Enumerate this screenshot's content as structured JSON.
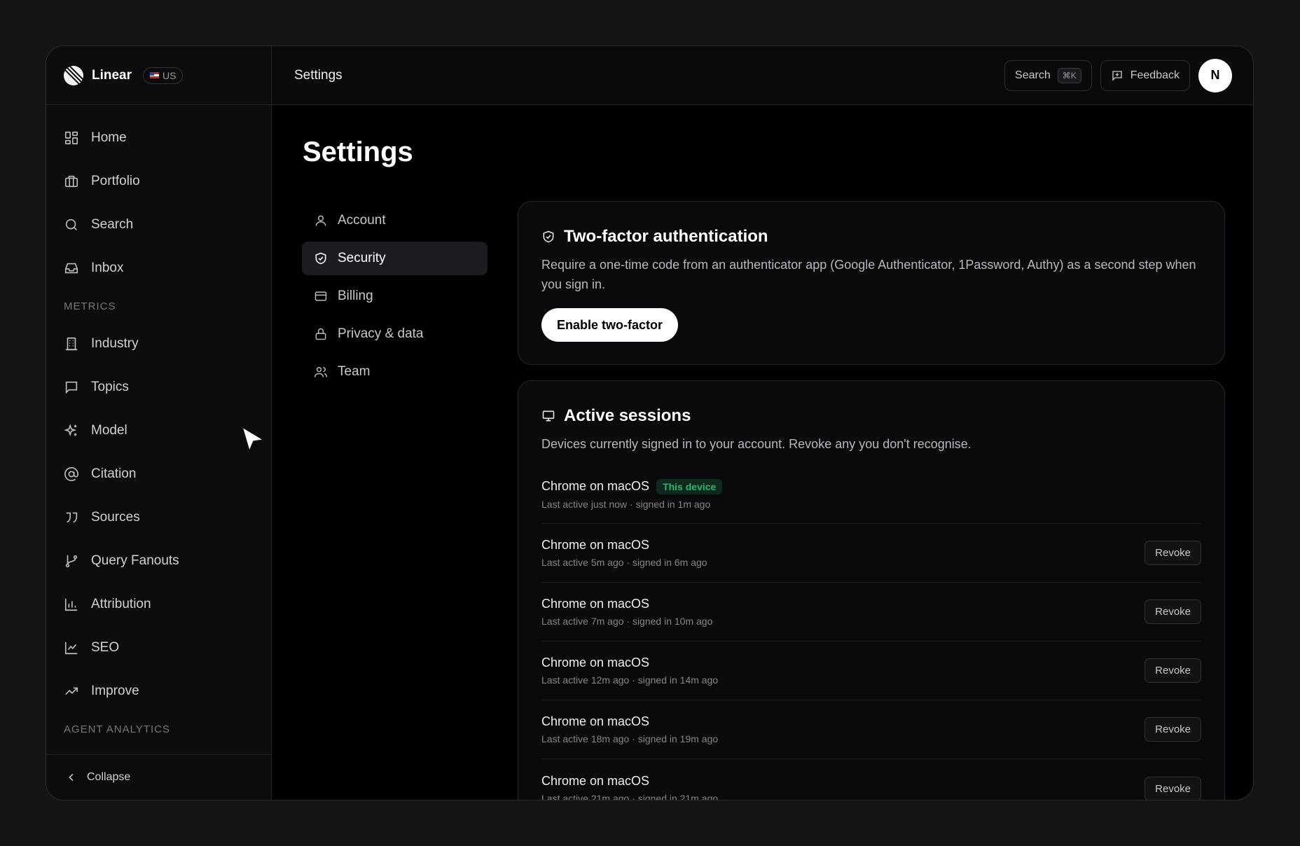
{
  "brand": {
    "name": "Linear",
    "region": "US"
  },
  "sidebar": {
    "main_items": [
      {
        "label": "Home",
        "icon": "dashboard-icon"
      },
      {
        "label": "Portfolio",
        "icon": "briefcase-icon"
      },
      {
        "label": "Search",
        "icon": "search-icon"
      },
      {
        "label": "Inbox",
        "icon": "inbox-icon"
      }
    ],
    "metrics_label": "METRICS",
    "metrics_items": [
      {
        "label": "Industry",
        "icon": "building-icon"
      },
      {
        "label": "Topics",
        "icon": "message-square-icon"
      },
      {
        "label": "Model",
        "icon": "sparkles-icon"
      },
      {
        "label": "Citation",
        "icon": "at-sign-icon"
      },
      {
        "label": "Sources",
        "icon": "quote-icon"
      },
      {
        "label": "Query Fanouts",
        "icon": "git-branch-icon"
      },
      {
        "label": "Attribution",
        "icon": "bar-chart-icon"
      },
      {
        "label": "SEO",
        "icon": "line-chart-icon"
      },
      {
        "label": "Improve",
        "icon": "trending-up-icon"
      }
    ],
    "agent_label": "AGENT ANALYTICS",
    "collapse_label": "Collapse"
  },
  "topbar": {
    "title": "Settings",
    "search_label": "Search",
    "search_shortcut": "⌘K",
    "feedback_label": "Feedback",
    "avatar_initial": "N"
  },
  "page": {
    "title": "Settings"
  },
  "subnav": [
    {
      "label": "Account",
      "icon": "user-icon",
      "active": false
    },
    {
      "label": "Security",
      "icon": "shield-check-icon",
      "active": true
    },
    {
      "label": "Billing",
      "icon": "credit-card-icon",
      "active": false
    },
    {
      "label": "Privacy & data",
      "icon": "lock-icon",
      "active": false
    },
    {
      "label": "Team",
      "icon": "users-icon",
      "active": false
    }
  ],
  "two_factor": {
    "title": "Two-factor authentication",
    "description": "Require a one-time code from an authenticator app (Google Authenticator, 1Password, Authy) as a second step when you sign in.",
    "button_label": "Enable two-factor"
  },
  "sessions": {
    "title": "Active sessions",
    "description": "Devices currently signed in to your account. Revoke any you don't recognise.",
    "this_device_label": "This device",
    "revoke_label": "Revoke",
    "items": [
      {
        "name": "Chrome on macOS",
        "meta": "Last active just now · signed in 1m ago",
        "current": true
      },
      {
        "name": "Chrome on macOS",
        "meta": "Last active 5m ago · signed in 6m ago",
        "current": false
      },
      {
        "name": "Chrome on macOS",
        "meta": "Last active 7m ago · signed in 10m ago",
        "current": false
      },
      {
        "name": "Chrome on macOS",
        "meta": "Last active 12m ago · signed in 14m ago",
        "current": false
      },
      {
        "name": "Chrome on macOS",
        "meta": "Last active 18m ago · signed in 19m ago",
        "current": false
      },
      {
        "name": "Chrome on macOS",
        "meta": "Last active 21m ago · signed in 21m ago",
        "current": false
      }
    ]
  },
  "colors": {
    "accent_green": "#2bb673",
    "background": "#000000"
  }
}
